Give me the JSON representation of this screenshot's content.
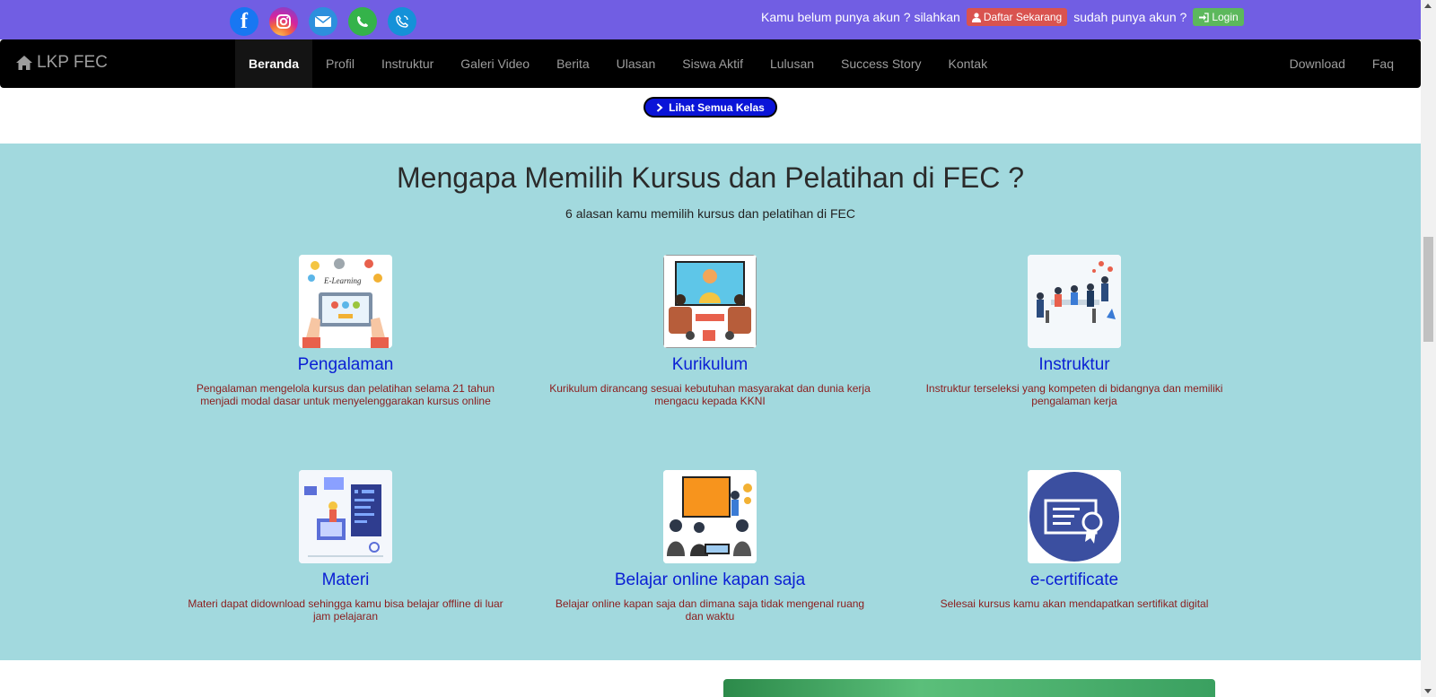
{
  "topbar": {
    "social": [
      "facebook-icon",
      "instagram-icon",
      "email-icon",
      "whatsapp-icon",
      "phone-icon"
    ],
    "no_account_text": "Kamu belum punya akun ? silahkan",
    "register_label": "Daftar Sekarang",
    "have_account_text": "sudah punya akun ?",
    "login_label": "Login"
  },
  "navbar": {
    "brand": "LKP FEC",
    "items": [
      "Beranda",
      "Profil",
      "Instruktur",
      "Galeri Video",
      "Berita",
      "Ulasan",
      "Siswa Aktif",
      "Lulusan",
      "Success Story",
      "Kontak"
    ],
    "right_items": [
      "Download",
      "Faq"
    ],
    "active": "Beranda"
  },
  "classes_button": "Lihat Semua Kelas",
  "why": {
    "title": "Mengapa Memilih Kursus dan Pelatihan di FEC ?",
    "subtitle": "6 alasan kamu memilih kursus dan pelatihan di FEC",
    "cards": [
      {
        "title": "Pengalaman",
        "desc": "Pengalaman mengelola kursus dan pelatihan selama 21 tahun menjadi modal dasar untuk menyelenggarakan kursus online",
        "icon": "elearning-illustration"
      },
      {
        "title": "Kurikulum",
        "desc": "Kurikulum dirancang sesuai kebutuhan masyarakat dan dunia kerja mengacu kepada KKNI",
        "icon": "video-class-illustration"
      },
      {
        "title": "Instruktur",
        "desc": "Instruktur terseleksi yang kompeten di bidangnya dan memiliki pengalaman kerja",
        "icon": "team-meeting-illustration"
      },
      {
        "title": "Materi",
        "desc": "Materi dapat didownload sehingga kamu bisa belajar offline di luar jam pelajaran",
        "icon": "learning-material-illustration"
      },
      {
        "title": "Belajar online kapan saja",
        "desc": "Belajar online kapan saja dan dimana saja tidak mengenal ruang dan waktu",
        "icon": "online-presentation-illustration"
      },
      {
        "title": "e-certificate",
        "desc": "Selesai kursus kamu akan mendapatkan sertifikat digital",
        "icon": "certificate-icon"
      }
    ]
  },
  "colors": {
    "topbar": "#715ee3",
    "section_bg": "#a2d9de",
    "card_title": "#0a1fd4",
    "card_desc": "#8b1c1c"
  }
}
